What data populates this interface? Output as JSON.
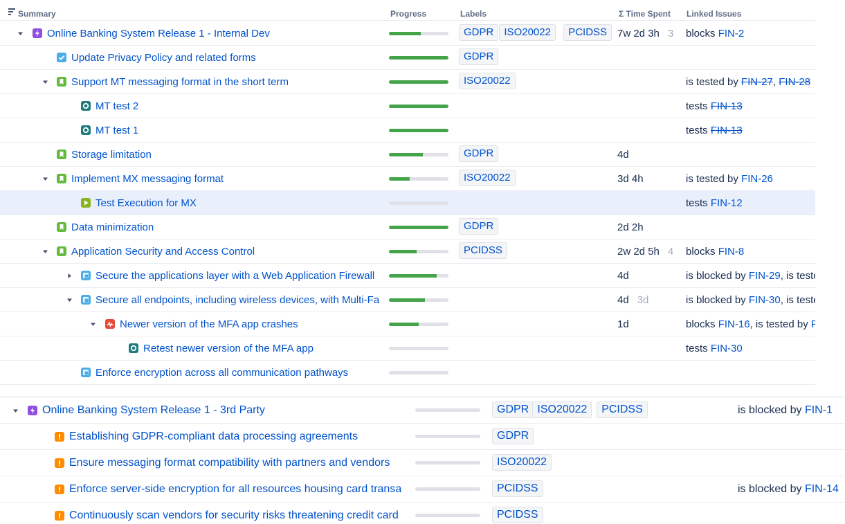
{
  "header": {
    "summary": "Summary",
    "progress": "Progress",
    "labels": "Labels",
    "time_spent": "Σ Time Spent",
    "linked_issues": "Linked Issues"
  },
  "colors": {
    "epic": "#904ee2",
    "task": "#4bade8",
    "story": "#63ba3c",
    "test": "#1f7a7a",
    "test_execution": "#8ab322",
    "bug": "#e5493a",
    "risk": "#ff8b00",
    "progress_fill": "#45a44a",
    "link": "#0052cc"
  },
  "table1": [
    {
      "title": "Online Banking System Release 1 - Internal Dev",
      "icon": "epic-icon",
      "expand": "expanded",
      "progress": 0.53,
      "labels": [
        "GDPR",
        "ISO20022",
        "PCIDSS"
      ],
      "time": "7w 2d 3h",
      "est": "3",
      "links": [
        {
          "t": "blocks "
        },
        {
          "k": "FIN-2"
        }
      ]
    },
    {
      "title": "Update Privacy Policy and related forms",
      "icon": "task-icon",
      "expand": "none",
      "progress": 1.0,
      "labels": [
        "GDPR"
      ],
      "time": "",
      "est": "",
      "links": []
    },
    {
      "title": "Support MT messaging format in the short term",
      "icon": "story-icon",
      "expand": "expanded",
      "progress": 1.0,
      "labels": [
        "ISO20022"
      ],
      "time": "",
      "est": "",
      "links": [
        {
          "t": "is tested by "
        },
        {
          "k": "FIN-27",
          "done": true
        },
        {
          "t": ", "
        },
        {
          "k": "FIN-28",
          "done": true
        }
      ]
    },
    {
      "title": "MT test 2",
      "icon": "test-icon",
      "expand": "none",
      "progress": 1.0,
      "labels": [],
      "time": "",
      "est": "",
      "links": [
        {
          "t": "tests "
        },
        {
          "k": "FIN-13",
          "done": true
        }
      ]
    },
    {
      "title": "MT test 1",
      "icon": "test-icon",
      "expand": "none",
      "progress": 1.0,
      "labels": [],
      "time": "",
      "est": "",
      "links": [
        {
          "t": "tests "
        },
        {
          "k": "FIN-13",
          "done": true
        }
      ]
    },
    {
      "title": "Storage limitation",
      "icon": "story-icon",
      "expand": "none",
      "progress": 0.57,
      "labels": [
        "GDPR"
      ],
      "time": "4d",
      "est": "",
      "links": []
    },
    {
      "title": "Implement MX messaging format",
      "icon": "story-icon",
      "expand": "expanded",
      "progress": 0.35,
      "labels": [
        "ISO20022"
      ],
      "time": "3d 4h",
      "est": "",
      "links": [
        {
          "t": "is tested by "
        },
        {
          "k": "FIN-26"
        }
      ]
    },
    {
      "title": "Test Execution for MX",
      "icon": "test-execution-icon",
      "expand": "none",
      "progress": 0.0,
      "labels": [],
      "time": "",
      "est": "",
      "links": [
        {
          "t": "tests "
        },
        {
          "k": "FIN-12"
        }
      ],
      "selected": true
    },
    {
      "title": "Data minimization",
      "icon": "story-icon",
      "expand": "none",
      "progress": 1.0,
      "labels": [
        "GDPR"
      ],
      "time": "2d 2h",
      "est": "",
      "links": []
    },
    {
      "title": "Application Security and Access Control",
      "icon": "story-icon",
      "expand": "expanded",
      "progress": 0.46,
      "labels": [
        "PCIDSS"
      ],
      "time": "2w 2d 5h",
      "est": "4",
      "links": [
        {
          "t": "blocks "
        },
        {
          "k": "FIN-8"
        }
      ]
    },
    {
      "title": "Secure the applications layer with a Web Application Firewall",
      "icon": "task-icon",
      "expand": "collapsed",
      "progress": 0.8,
      "labels": [],
      "time": "4d",
      "est": "",
      "links": [
        {
          "t": "is blocked by "
        },
        {
          "k": "FIN-29"
        },
        {
          "t": ", is teste"
        }
      ]
    },
    {
      "title": "Secure all endpoints, including wireless devices, with Multi-Fa",
      "icon": "task-icon",
      "expand": "expanded",
      "progress": 0.6,
      "labels": [],
      "time": "4d",
      "est": "3d",
      "links": [
        {
          "t": "is blocked by "
        },
        {
          "k": "FIN-30"
        },
        {
          "t": ", is teste"
        }
      ]
    },
    {
      "title": "Newer version of the MFA app crashes",
      "icon": "bug-icon",
      "expand": "expanded",
      "progress": 0.5,
      "labels": [],
      "time": "1d",
      "est": "",
      "links": [
        {
          "t": "blocks "
        },
        {
          "k": "FIN-16"
        },
        {
          "t": ", is tested by "
        },
        {
          "k": "FI"
        }
      ]
    },
    {
      "title": "Retest newer version of the MFA app",
      "icon": "test-icon",
      "expand": "none",
      "progress": 0.0,
      "labels": [],
      "time": "",
      "est": "",
      "links": [
        {
          "t": "tests "
        },
        {
          "k": "FIN-30"
        }
      ]
    },
    {
      "title": "Enforce encryption across all communication pathways",
      "icon": "task-icon",
      "expand": "none",
      "progress": 0.0,
      "labels": [],
      "time": "",
      "est": "",
      "links": []
    }
  ],
  "table2": [
    {
      "title": "Online Banking System Release 1 - 3rd Party",
      "icon": "epic-icon",
      "expand": "expanded",
      "progress": 0.0,
      "labels": [
        "GDPR",
        "ISO20022",
        "PCIDSS"
      ],
      "links": [
        {
          "t": "is blocked by "
        },
        {
          "k": "FIN-1"
        }
      ]
    },
    {
      "title": "Establishing GDPR-compliant data processing agreements",
      "icon": "risk-icon",
      "expand": "none",
      "progress": 0.0,
      "labels": [
        "GDPR"
      ],
      "links": []
    },
    {
      "title": "Ensure messaging format compatibility with partners and vendors",
      "icon": "risk-icon",
      "expand": "none",
      "progress": 0.0,
      "labels": [
        "ISO20022"
      ],
      "links": []
    },
    {
      "title": "Enforce server-side encryption for all resources housing card transa",
      "icon": "risk-icon",
      "expand": "none",
      "progress": 0.0,
      "labels": [
        "PCIDSS"
      ],
      "links": [
        {
          "t": "is blocked by "
        },
        {
          "k": "FIN-14"
        }
      ]
    },
    {
      "title": "Continuously scan vendors for security risks threatening credit card",
      "icon": "risk-icon",
      "expand": "none",
      "progress": 0.0,
      "labels": [
        "PCIDSS"
      ],
      "links": []
    }
  ]
}
